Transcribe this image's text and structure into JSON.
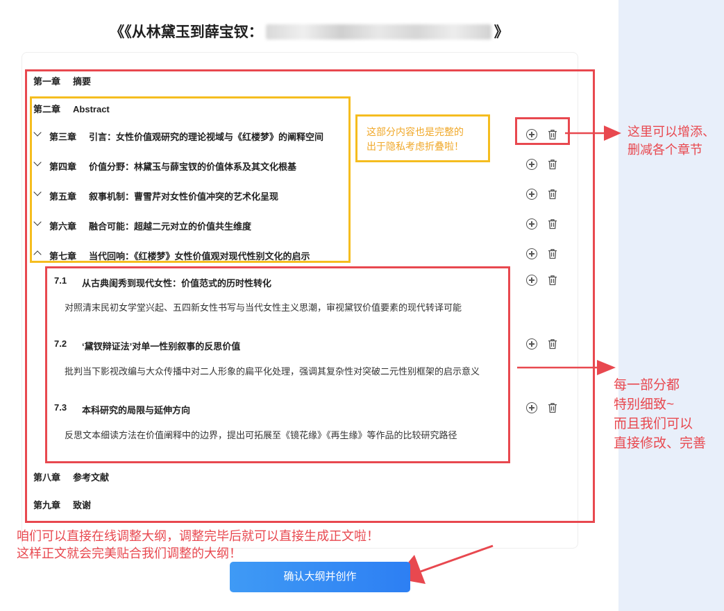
{
  "page": {
    "title_prefix": "《《从林黛玉到薛宝钗：",
    "title_suffix": "》",
    "confirm_button": "确认大纲并创作"
  },
  "outline": {
    "chapters": [
      {
        "num": "第一章",
        "title": "摘要"
      },
      {
        "num": "第二章",
        "title": "Abstract"
      },
      {
        "num": "第三章",
        "title": "引言：女性价值观研究的理论视域与《红楼梦》的阐释空间"
      },
      {
        "num": "第四章",
        "title": "价值分野：林黛玉与薛宝钗的价值体系及其文化根基"
      },
      {
        "num": "第五章",
        "title": "叙事机制：曹雪芹对女性价值冲突的艺术化呈现"
      },
      {
        "num": "第六章",
        "title": "融合可能：超越二元对立的价值共生维度"
      },
      {
        "num": "第七章",
        "title": "当代回响：《红楼梦》女性价值观对现代性别文化的启示"
      },
      {
        "num": "第八章",
        "title": "参考文献"
      },
      {
        "num": "第九章",
        "title": "致谢"
      }
    ],
    "sections": [
      {
        "num": "7.1",
        "title": "从古典闺秀到现代女性：价值范式的历时性转化",
        "desc": "对照清末民初女学堂兴起、五四新女性书写与当代女性主义思潮，审视黛钗价值要素的现代转译可能"
      },
      {
        "num": "7.2",
        "title": "‘黛钗辩证法’对单一性别叙事的反思价值",
        "desc": "批判当下影视改编与大众传播中对二人形象的扁平化处理，强调其复杂性对突破二元性别框架的启示意义"
      },
      {
        "num": "7.3",
        "title": "本科研究的局限与延伸方向",
        "desc": "反思文本细读方法在价值阐释中的边界，提出可拓展至《镜花缘》《再生缘》等作品的比较研究路径"
      }
    ]
  },
  "annotations": {
    "yellow_note_line1": "这部分内容也是完整的",
    "yellow_note_line2": "出于隐私考虑折叠啦！",
    "right_note_top_line1": "这里可以增添、",
    "right_note_top_line2": "删减各个章节",
    "right_note_mid_line1": "每一部分都",
    "right_note_mid_line2": "特别细致~",
    "right_note_mid_line3": "而且我们可以",
    "right_note_mid_line4": "直接修改、完善",
    "bottom_note_line1": "咱们可以直接在线调整大纲，调整完毕后就可以直接生成正文啦！",
    "bottom_note_line2": "这样正文就会完美贴合我们调整的大纲！"
  },
  "colors": {
    "annotation_red": "#e8484f",
    "annotation_yellow": "#f5bd1f",
    "button_blue": "#2d7ff3",
    "side_panel": "#e8effa"
  },
  "icons": [
    "chevron-down-icon",
    "chevron-up-icon",
    "add-circle-icon",
    "trash-icon"
  ]
}
